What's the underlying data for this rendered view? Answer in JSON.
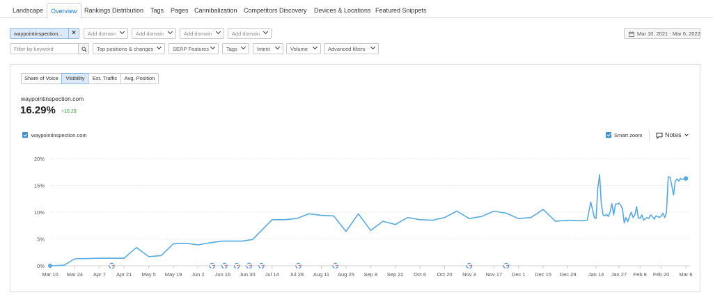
{
  "tabs": [
    {
      "label": "Landscape",
      "active": false
    },
    {
      "label": "Overview",
      "active": true
    },
    {
      "label": "Rankings Distribution",
      "active": false
    },
    {
      "label": "Tags",
      "active": false
    },
    {
      "label": "Pages",
      "active": false
    },
    {
      "label": "Cannibalization",
      "active": false
    },
    {
      "label": "Competitors Discovery",
      "active": false
    },
    {
      "label": "Devices & Locations",
      "active": false
    },
    {
      "label": "Featured Snippets",
      "active": false
    }
  ],
  "filters": {
    "domain": "waypointinspection...",
    "remove_icon": "close-icon",
    "add_domain": [
      "Add domain",
      "Add domain",
      "Add domain",
      "Add domain"
    ],
    "keyword_placeholder": "Filter by keyword",
    "search_icon": "search-icon",
    "dropdowns": [
      "Top positions & changes",
      "SERP Features",
      "Tags",
      "Intent",
      "Volume",
      "Advanced filters"
    ],
    "date_range": "Mar 10, 2021 - Mar 6, 2022",
    "calendar_icon": "calendar-icon"
  },
  "metrics_tabs": [
    {
      "label": "Share of Voice",
      "active": false
    },
    {
      "label": "Visibility",
      "active": true
    },
    {
      "label": "Est. Traffic",
      "active": false
    },
    {
      "label": "Avg. Position",
      "active": false
    }
  ],
  "summary": {
    "domain": "waypointinspection.com",
    "value": "16.29%",
    "change": "+16.29",
    "change_color": "#3a9a3a"
  },
  "legend": {
    "series_label": "waypointinspection.com",
    "smart_zoom_label": "Smart zoom",
    "notes_label": "Notes",
    "notes_icon": "comment-icon"
  },
  "colors": {
    "accent": "#1e78d6",
    "series": "#55a9e4",
    "selected_bg": "#dbe9f8"
  },
  "chart_data": {
    "type": "line",
    "title": "",
    "xlabel": "",
    "ylabel": "",
    "ylim": [
      0,
      20
    ],
    "y_ticks": [
      0,
      5,
      10,
      15,
      20
    ],
    "y_tick_labels": [
      "0%",
      "5%",
      "10%",
      "15%",
      "20%"
    ],
    "x_range": [
      "2021-03-10",
      "2022-03-06"
    ],
    "x_ticks": [
      "2021-03-10",
      "2021-03-24",
      "2021-04-07",
      "2021-04-21",
      "2021-05-05",
      "2021-05-19",
      "2021-06-02",
      "2021-06-16",
      "2021-06-30",
      "2021-07-14",
      "2021-07-28",
      "2021-08-11",
      "2021-08-25",
      "2021-09-08",
      "2021-09-22",
      "2021-10-06",
      "2021-10-20",
      "2021-11-03",
      "2021-11-17",
      "2021-12-01",
      "2021-12-15",
      "2021-12-29",
      "2022-01-14",
      "2022-01-27",
      "2022-02-08",
      "2022-02-20",
      "2022-03-06"
    ],
    "x_tick_labels": [
      "Mar 10",
      "Mar 24",
      "Apr 7",
      "Apr 21",
      "May 5",
      "May 19",
      "Jun 2",
      "Jun 16",
      "Jun 30",
      "Jul 14",
      "Jul 28",
      "Aug 11",
      "Aug 25",
      "Sep 8",
      "Sep 22",
      "Oct 6",
      "Oct 20",
      "Nov 3",
      "Nov 17",
      "Dec 1",
      "Dec 15",
      "Dec 29",
      "Jan 14",
      "Jan 27",
      "Feb 8",
      "Feb 20",
      "Mar 6"
    ],
    "grid": true,
    "google_update_markers": [
      "2021-04-14",
      "2021-06-10",
      "2021-06-17",
      "2021-06-24",
      "2021-07-01",
      "2021-07-08",
      "2021-07-29",
      "2021-08-19",
      "2021-11-03",
      "2021-11-24"
    ],
    "google_marker_icon": "google-icon",
    "series": [
      {
        "name": "waypointinspection.com",
        "x": [
          "2021-03-10",
          "2021-03-18",
          "2021-03-24",
          "2021-04-07",
          "2021-04-21",
          "2021-04-28",
          "2021-05-05",
          "2021-05-12",
          "2021-05-19",
          "2021-05-26",
          "2021-06-02",
          "2021-06-09",
          "2021-06-16",
          "2021-06-23",
          "2021-06-27",
          "2021-07-03",
          "2021-07-14",
          "2021-07-21",
          "2021-07-28",
          "2021-08-04",
          "2021-08-11",
          "2021-08-18",
          "2021-08-25",
          "2021-09-01",
          "2021-09-08",
          "2021-09-15",
          "2021-09-22",
          "2021-09-29",
          "2021-10-06",
          "2021-10-13",
          "2021-10-20",
          "2021-10-27",
          "2021-11-03",
          "2021-11-10",
          "2021-11-17",
          "2021-11-24",
          "2021-12-01",
          "2021-12-08",
          "2021-12-15",
          "2021-12-22",
          "2021-12-29",
          "2022-01-05",
          "2022-01-09",
          "2022-01-11",
          "2022-01-12",
          "2022-01-13",
          "2022-01-14",
          "2022-01-15",
          "2022-01-16",
          "2022-01-17",
          "2022-01-18",
          "2022-01-19",
          "2022-01-20",
          "2022-01-21",
          "2022-01-22",
          "2022-01-23",
          "2022-01-24",
          "2022-01-25",
          "2022-01-26",
          "2022-01-27",
          "2022-01-28",
          "2022-01-29",
          "2022-01-30",
          "2022-01-31",
          "2022-02-01",
          "2022-02-02",
          "2022-02-03",
          "2022-02-04",
          "2022-02-05",
          "2022-02-06",
          "2022-02-07",
          "2022-02-08",
          "2022-02-09",
          "2022-02-10",
          "2022-02-11",
          "2022-02-12",
          "2022-02-13",
          "2022-02-14",
          "2022-02-15",
          "2022-02-16",
          "2022-02-17",
          "2022-02-18",
          "2022-02-19",
          "2022-02-20",
          "2022-02-21",
          "2022-02-22",
          "2022-02-23",
          "2022-02-24",
          "2022-02-25",
          "2022-02-26",
          "2022-02-27",
          "2022-02-28",
          "2022-03-01",
          "2022-03-02",
          "2022-03-03",
          "2022-03-04",
          "2022-03-06"
        ],
        "y": [
          0,
          0.1,
          1.3,
          1.4,
          1.4,
          3.4,
          1.7,
          1.9,
          4.1,
          4.2,
          3.9,
          4.3,
          4.6,
          4.6,
          4.6,
          4.9,
          8.6,
          8.6,
          8.8,
          9.7,
          9.4,
          9.3,
          6.4,
          9.7,
          6.6,
          8.3,
          7.7,
          9.0,
          8.6,
          8.5,
          9.0,
          10.2,
          8.8,
          9.2,
          10.2,
          9.8,
          8.8,
          9.0,
          10.5,
          8.3,
          8.5,
          8.4,
          8.5,
          11.9,
          10.5,
          9.0,
          8.8,
          14.5,
          17.0,
          11.5,
          9.5,
          9.3,
          9.6,
          9.2,
          10.0,
          11.6,
          9.5,
          11.5,
          11.5,
          11.7,
          11.3,
          10.6,
          8.0,
          9.0,
          8.2,
          9.2,
          10.0,
          9.0,
          9.5,
          11.0,
          9.0,
          8.8,
          9.5,
          8.5,
          8.8,
          9.0,
          8.8,
          9.5,
          9.2,
          8.7,
          9.3,
          9.2,
          9.0,
          9.3,
          9.8,
          9.0,
          10.0,
          16.6,
          16.5,
          15.0,
          13.2,
          15.8,
          16.2,
          15.8,
          16.3,
          16.1,
          16.29
        ]
      }
    ]
  }
}
